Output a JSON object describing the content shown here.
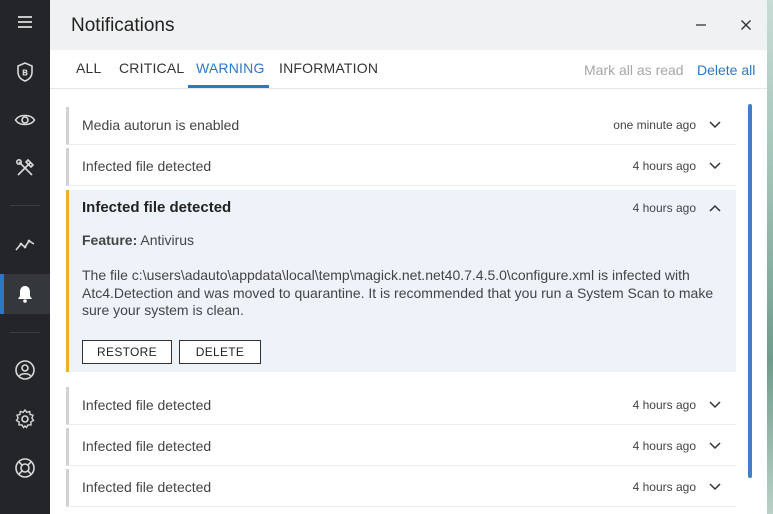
{
  "window": {
    "title": "Notifications"
  },
  "sidebar": {
    "items": [
      {
        "name": "menu",
        "icon": "hamburger-menu-icon"
      },
      {
        "name": "protection",
        "icon": "bitdefender-shield-icon"
      },
      {
        "name": "privacy",
        "icon": "eye-icon"
      },
      {
        "name": "utilities",
        "icon": "tools-icon"
      },
      {
        "name": "reports",
        "icon": "activity-graph-icon"
      },
      {
        "name": "notifications",
        "icon": "bell-icon",
        "active": true
      },
      {
        "name": "account",
        "icon": "user-circle-icon"
      },
      {
        "name": "settings",
        "icon": "gear-icon"
      },
      {
        "name": "support",
        "icon": "lifebuoy-icon"
      }
    ]
  },
  "tabs": {
    "items": [
      "ALL",
      "CRITICAL",
      "WARNING",
      "INFORMATION"
    ],
    "active": "WARNING",
    "mark_all_read": "Mark all as read",
    "delete_all": "Delete all"
  },
  "notifications": [
    {
      "title": "Media autorun is enabled",
      "time": "one minute ago"
    },
    {
      "title": "Infected file detected",
      "time": "4 hours ago"
    },
    {
      "title": "Infected file detected",
      "time": "4 hours ago",
      "expanded": true,
      "feature_label": "Feature:",
      "feature_value": "Antivirus",
      "description": "The file c:\\users\\adauto\\appdata\\local\\temp\\magick.net.net40.7.4.5.0\\configure.xml is infected with Atc4.Detection and was moved to quarantine. It is recommended that you run a System Scan to make sure your system is clean.",
      "restore_label": "RESTORE",
      "delete_label": "DELETE"
    },
    {
      "title": "Infected file detected",
      "time": "4 hours ago"
    },
    {
      "title": "Infected file detected",
      "time": "4 hours ago"
    },
    {
      "title": "Infected file detected",
      "time": "4 hours ago"
    }
  ],
  "colors": {
    "accent": "#2b78c8",
    "warning_stripe": "#f0ad2e",
    "sidebar_bg": "#232529",
    "expanded_bg": "#eef3fa"
  }
}
